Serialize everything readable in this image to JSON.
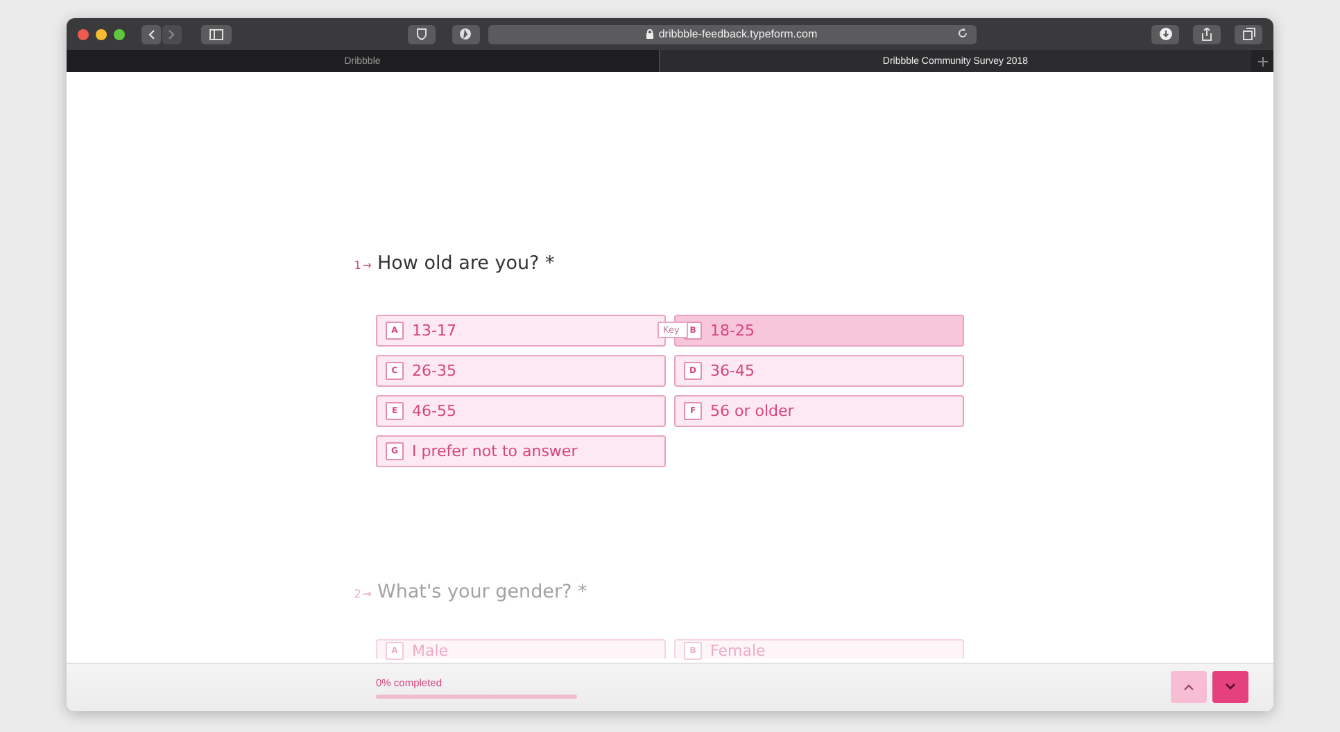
{
  "browser": {
    "url": "dribbble-feedback.typeform.com",
    "tabs": [
      {
        "label": "Dribbble",
        "selected": false
      },
      {
        "label": "Dribbble Community Survey 2018",
        "selected": true
      }
    ]
  },
  "questions": [
    {
      "number": "1",
      "arrow": "→",
      "title": "How old are you? *",
      "faded": false,
      "choices": [
        {
          "key": "A",
          "label": "13-17",
          "selected": false
        },
        {
          "key": "B",
          "label": "18-25",
          "selected": true,
          "hint": "Key"
        },
        {
          "key": "C",
          "label": "26-35",
          "selected": false
        },
        {
          "key": "D",
          "label": "36-45",
          "selected": false
        },
        {
          "key": "E",
          "label": "46-55",
          "selected": false
        },
        {
          "key": "F",
          "label": "56 or older",
          "selected": false
        },
        {
          "key": "G",
          "label": "I prefer not to answer",
          "selected": false
        }
      ]
    },
    {
      "number": "2",
      "arrow": "→",
      "title": "What's your gender? *",
      "faded": true,
      "choices": [
        {
          "key": "A",
          "label": "Male",
          "selected": false
        },
        {
          "key": "B",
          "label": "Female",
          "selected": false
        }
      ]
    }
  ],
  "footer": {
    "progress_text": "0% completed",
    "level": 0
  }
}
